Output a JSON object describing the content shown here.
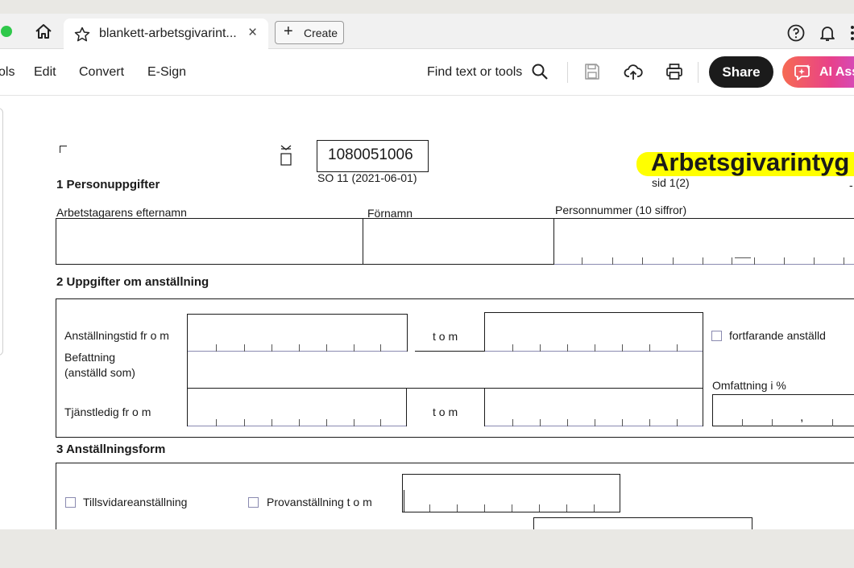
{
  "browser": {
    "tab_title": "blankett-arbetsgivarint...",
    "tab_close": "×",
    "create_label": "Create",
    "icons": [
      "home-icon",
      "star-icon",
      "help-icon",
      "bell-icon",
      "more-icon"
    ]
  },
  "toolbar": {
    "menu": [
      "ols",
      "Edit",
      "Convert",
      "E-Sign"
    ],
    "find_label": "Find text or tools",
    "share_label": "Share",
    "ai_label": "AI Ass",
    "icons": [
      "search-icon",
      "save-icon",
      "upload-cloud-icon",
      "print-icon",
      "ai-assistant-icon"
    ]
  },
  "document": {
    "form_number": "1080051006",
    "form_code": "SO 11 (2021-06-01)",
    "title": "Arbetsgivarintyg",
    "page_indicator": "sid 1(2)",
    "sections": {
      "s1": "1 Personuppgifter",
      "s2": "2 Uppgifter om anställning",
      "s3": "3 Anställningsform"
    },
    "labels": {
      "efternamn": "Arbetstagarens efternamn",
      "fornamn": "Förnamn",
      "personnummer": "Personnummer (10 siffror)",
      "anst_from": "Anställningstid fr o m",
      "tom": "t o m",
      "fortfarande": "fortfarande anställd",
      "befattning_1": "Befattning",
      "befattning_2": "(anställd som)",
      "omfattning": "Omfattning i %",
      "tjanstledig": "Tjänstledig fr o m",
      "tom2": "t o m",
      "decimal_comma": ",",
      "tillsvidare": "Tillsvidareanställning",
      "provanst": "Provanställning t o m"
    }
  },
  "colors": {
    "highlight": "#ffff00",
    "share_bg": "#1b1b1b",
    "traffic_green": "#2fc84a"
  }
}
